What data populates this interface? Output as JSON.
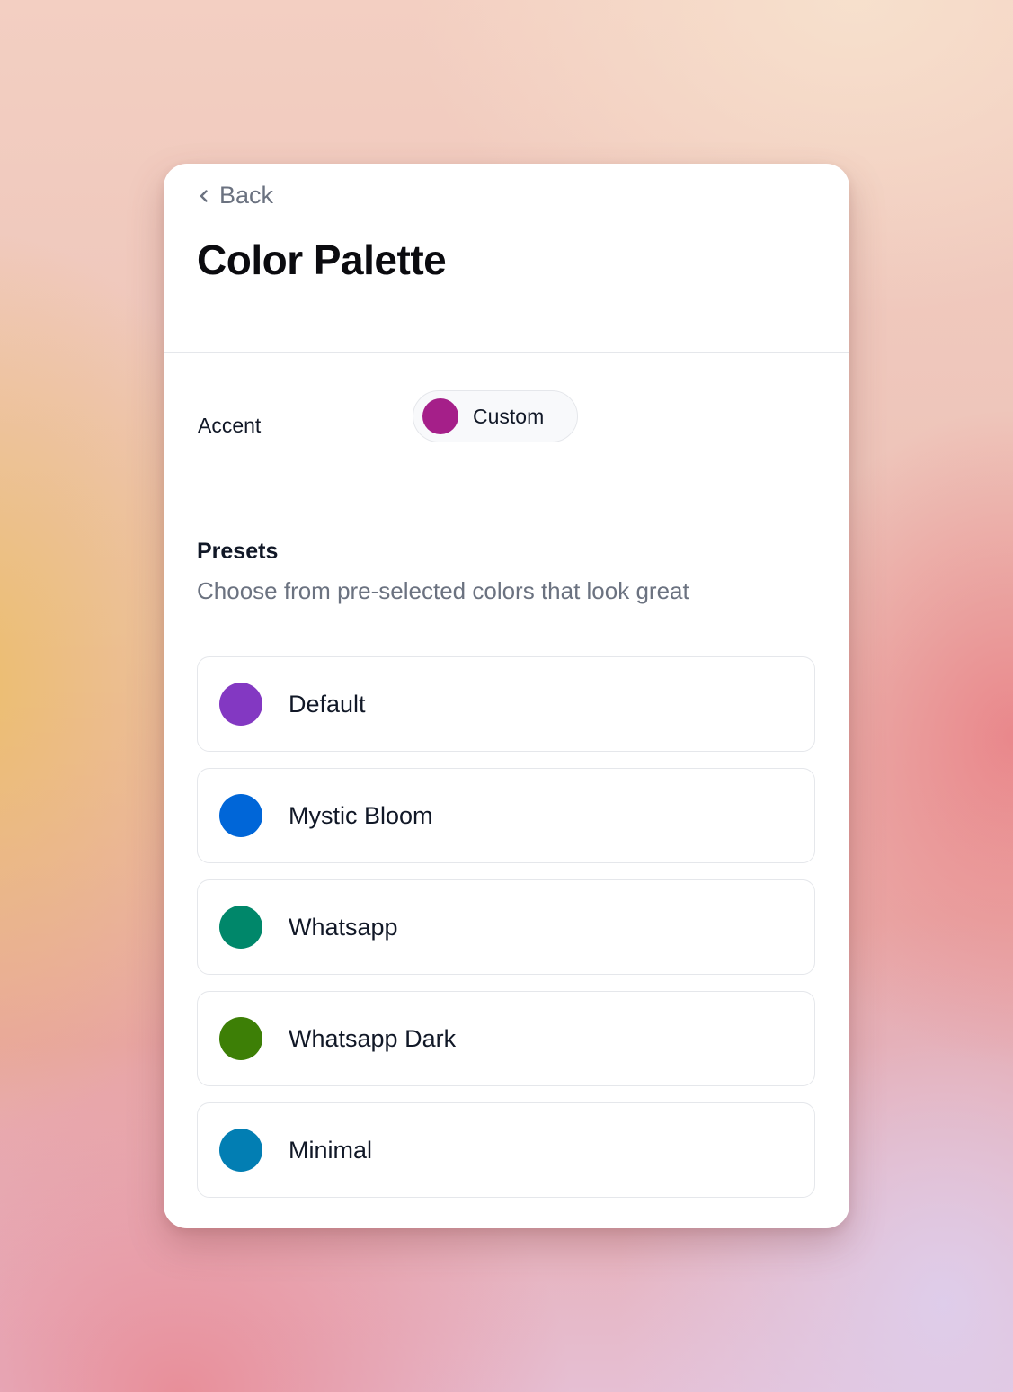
{
  "header": {
    "back_label": "Back",
    "back_icon": "chevron-left-icon",
    "title": "Color Palette"
  },
  "accent": {
    "label": "Accent",
    "value": "Custom",
    "color": "#a51f89"
  },
  "presets": {
    "title": "Presets",
    "subtitle": "Choose from pre-selected colors that look great",
    "items": [
      {
        "label": "Default",
        "color": "#8338c2"
      },
      {
        "label": "Mystic Bloom",
        "color": "#0066d8"
      },
      {
        "label": "Whatsapp",
        "color": "#00876a"
      },
      {
        "label": "Whatsapp Dark",
        "color": "#3d7f06"
      },
      {
        "label": "Minimal",
        "color": "#027eb3"
      }
    ]
  }
}
